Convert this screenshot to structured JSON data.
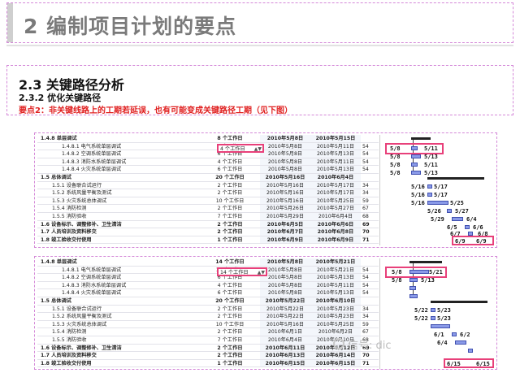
{
  "slide_title": "2 编制项目计划的要点",
  "section_heading": "2.3 关键路径分析",
  "subsection_heading": "2.3.2 优化关键路径",
  "key_point_note": "要点2：非关键线路上的工期若延误，也有可能变成关键路径工期（见下图）",
  "gantt_top": {
    "rows": [
      {
        "name": "1.4.8 单层调试",
        "duration": "8 个工作日",
        "start": "2010年5月8日",
        "end": "2010年5月15日",
        "pred": "",
        "type": "summary",
        "level": 1
      },
      {
        "name": "1.4.8.1 电气系统单层调试",
        "duration": "4 个工作日",
        "start": "2010年5月8日",
        "end": "2010年5月11日",
        "pred": "54",
        "type": "task",
        "level": 3
      },
      {
        "name": "1.4.8.2 空调系统单层调试",
        "duration": "6 个工作日",
        "start": "2010年5月8日",
        "end": "2010年5月13日",
        "pred": "54",
        "type": "task",
        "level": 3
      },
      {
        "name": "1.4.8.3 消防水系统单层调试",
        "duration": "4 个工作日",
        "start": "2010年5月8日",
        "end": "2010年5月11日",
        "pred": "54",
        "type": "task",
        "level": 3
      },
      {
        "name": "1.4.8.4 火灾系统单层调试",
        "duration": "6 个工作日",
        "start": "2010年5月8日",
        "end": "2010年5月13日",
        "pred": "54",
        "type": "task",
        "level": 3
      },
      {
        "name": "1.5 总体调试",
        "duration": "20 个工作日",
        "start": "2010年5月16日",
        "end": "2010年6月4日",
        "pred": "",
        "type": "summary",
        "level": 1
      },
      {
        "name": "1.5.1 设备联合试运行",
        "duration": "2 个工作日",
        "start": "2010年5月16日",
        "end": "2010年5月17日",
        "pred": "34",
        "type": "task",
        "level": 2
      },
      {
        "name": "1.5.2 系统风量平衡及测试",
        "duration": "2 个工作日",
        "start": "2010年5月16日",
        "end": "2010年5月17日",
        "pred": "34",
        "type": "task",
        "level": 2
      },
      {
        "name": "1.5.3 火灾系统总体调试",
        "duration": "10 个工作日",
        "start": "2010年5月16日",
        "end": "2010年5月25日",
        "pred": "59",
        "type": "task",
        "level": 2
      },
      {
        "name": "1.5.4 消防检测",
        "duration": "2 个工作日",
        "start": "2010年5月26日",
        "end": "2010年5月27日",
        "pred": "67",
        "type": "task",
        "level": 2
      },
      {
        "name": "1.5.5 消防验收",
        "duration": "7 个工作日",
        "start": "2010年5月29日",
        "end": "2010年6月4日",
        "pred": "68",
        "type": "task",
        "level": 2
      },
      {
        "name": "1.6 设备标示、调整修补、卫生清洁",
        "duration": "2 个工作日",
        "start": "2010年6月5日",
        "end": "2010年6月6日",
        "pred": "69",
        "type": "summary",
        "level": 1
      },
      {
        "name": "1.7 人员培训及资料移交",
        "duration": "2 个工作日",
        "start": "2010年6月7日",
        "end": "2010年6月8日",
        "pred": "70",
        "type": "summary",
        "level": 1
      },
      {
        "name": "1.8 竣工验收交付使用",
        "duration": "1 个工作日",
        "start": "2010年6月9日",
        "end": "2010年6月9日",
        "pred": "71",
        "type": "summary",
        "level": 1
      }
    ],
    "edited_cell": "4 个工作日",
    "chart_labels": [
      "5/8",
      "5/11",
      "5/8",
      "5/13",
      "5/8",
      "5/11",
      "5/8",
      "5/13",
      "5/16",
      "5/17",
      "5/16",
      "5/17",
      "5/16",
      "5/25",
      "5/26",
      "5/27",
      "5/29",
      "6/4",
      "6/5",
      "6/6",
      "6/7",
      "6/8",
      "6/9",
      "6/9"
    ]
  },
  "gantt_bottom": {
    "rows": [
      {
        "name": "1.4.8 单层调试",
        "duration": "14 个工作日",
        "start": "2010年5月8日",
        "end": "2010年5月21日",
        "pred": "",
        "type": "summary",
        "level": 1
      },
      {
        "name": "1.4.8.1 电气系统单层调试",
        "duration": "14 个工作日",
        "start": "2010年5月8日",
        "end": "2010年5月21日",
        "pred": "54",
        "type": "task",
        "level": 3
      },
      {
        "name": "1.4.8.2 空调系统单层调试",
        "duration": "6 个工作日",
        "start": "2010年5月8日",
        "end": "2010年5月13日",
        "pred": "54",
        "type": "task",
        "level": 3
      },
      {
        "name": "1.4.8.3 消防水系统单层调试",
        "duration": "4 个工作日",
        "start": "2010年5月8日",
        "end": "2010年5月11日",
        "pred": "54",
        "type": "task",
        "level": 3
      },
      {
        "name": "1.4.8.4 火灾系统单层调试",
        "duration": "6 个工作日",
        "start": "2010年5月8日",
        "end": "2010年5月13日",
        "pred": "54",
        "type": "task",
        "level": 3
      },
      {
        "name": "1.5 总体调试",
        "duration": "20 个工作日",
        "start": "2010年5月22日",
        "end": "2010年6月10日",
        "pred": "",
        "type": "summary",
        "level": 1
      },
      {
        "name": "1.5.1 设备联合试运行",
        "duration": "2 个工作日",
        "start": "2010年5月22日",
        "end": "2010年5月23日",
        "pred": "34",
        "type": "task",
        "level": 2
      },
      {
        "name": "1.5.2 系统风量平衡及测试",
        "duration": "2 个工作日",
        "start": "2010年5月22日",
        "end": "2010年5月23日",
        "pred": "34",
        "type": "task",
        "level": 2
      },
      {
        "name": "1.5.3 火灾系统总体调试",
        "duration": "10 个工作日",
        "start": "2010年5月16日",
        "end": "2010年5月25日",
        "pred": "59",
        "type": "task",
        "level": 2
      },
      {
        "name": "1.5.4 消防检测",
        "duration": "2 个工作日",
        "start": "2010年6月1日",
        "end": "2010年6月2日",
        "pred": "67",
        "type": "task",
        "level": 2
      },
      {
        "name": "1.5.5 消防验收",
        "duration": "7 个工作日",
        "start": "2010年6月4日",
        "end": "2010年6月10日",
        "pred": "68",
        "type": "task",
        "level": 2
      },
      {
        "name": "1.6 设备标示、调整修补、卫生清洁",
        "duration": "2 个工作日",
        "start": "2010年6月11日",
        "end": "2010年6月12日",
        "pred": "69",
        "type": "summary",
        "level": 1
      },
      {
        "name": "1.7 人员培训及资料移交",
        "duration": "2 个工作日",
        "start": "2010年6月13日",
        "end": "2010年6月14日",
        "pred": "70",
        "type": "summary",
        "level": 1
      },
      {
        "name": "1.8 竣工验收交付使用",
        "duration": "1 个工作日",
        "start": "2010年6月15日",
        "end": "2010年6月15日",
        "pred": "71",
        "type": "summary",
        "level": 1
      }
    ],
    "edited_cell": "14 个工作日",
    "chart_labels": [
      "5/8",
      "5/21",
      "5/8",
      "5/13",
      "5/22",
      "5/23",
      "5/22",
      "5/23",
      "6/1",
      "6/2",
      "6/4",
      "6/15",
      "6/15"
    ]
  },
  "watermark": "信号: dic"
}
